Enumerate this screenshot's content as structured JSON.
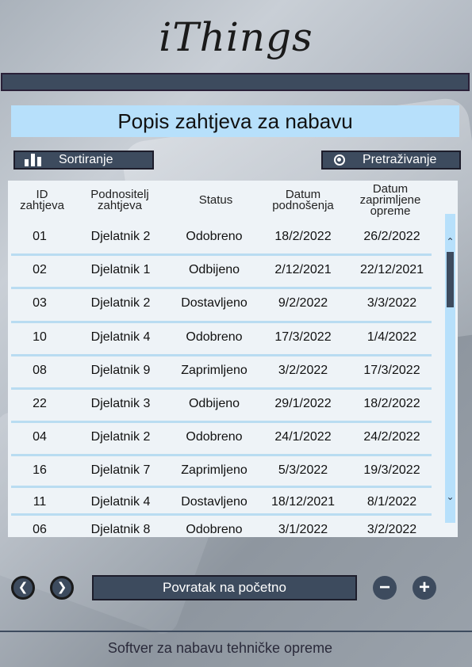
{
  "app": {
    "logo": "iThings"
  },
  "title": "Popis zahtjeva za nabavu",
  "toolbar": {
    "sort_label": "Sortiranje",
    "search_label": "Pretraživanje"
  },
  "table": {
    "headers": [
      [
        "ID",
        "zahtjeva"
      ],
      [
        "Podnositelj",
        "zahtjeva"
      ],
      [
        "Status"
      ],
      [
        "Datum",
        "podnošenja"
      ],
      [
        "Datum",
        "zaprimljene",
        "opreme"
      ]
    ],
    "rows": [
      [
        "01",
        "Djelatnik 2",
        "Odobreno",
        "18/2/2022",
        "26/2/2022"
      ],
      [
        "02",
        "Djelatnik 1",
        "Odbijeno",
        "2/12/2021",
        "22/12/2021"
      ],
      [
        "03",
        "Djelatnik 2",
        "Dostavljeno",
        "9/2/2022",
        "3/3/2022"
      ],
      [
        "10",
        "Djelatnik 4",
        "Odobreno",
        "17/3/2022",
        "1/4/2022"
      ],
      [
        "08",
        "Djelatnik 9",
        "Zaprimljeno",
        "3/2/2022",
        "17/3/2022"
      ],
      [
        "22",
        "Djelatnik 3",
        "Odbijeno",
        "29/1/2022",
        "18/2/2022"
      ],
      [
        "04",
        "Djelatnik 2",
        "Odobreno",
        "24/1/2022",
        "24/2/2022"
      ],
      [
        "16",
        "Djelatnik 7",
        "Zaprimljeno",
        "5/3/2022",
        "19/3/2022"
      ],
      [
        "11",
        "Djelatnik 4",
        "Dostavljeno",
        "18/12/2021",
        "8/1/2022"
      ],
      [
        "06",
        "Djelatnik 8",
        "Odobreno",
        "3/1/2022",
        "3/2/2022"
      ]
    ]
  },
  "bottom": {
    "home_label": "Povratak na početno",
    "back_icon": "chevron-left-icon",
    "forward_icon": "chevron-right-icon",
    "zoom_out_icon": "minus-icon",
    "zoom_in_icon": "plus-icon"
  },
  "footer": {
    "text": "Softver za nabavu tehničke opreme"
  },
  "colors": {
    "accent": "#b7e0fb",
    "dark": "#3d4b5e"
  }
}
